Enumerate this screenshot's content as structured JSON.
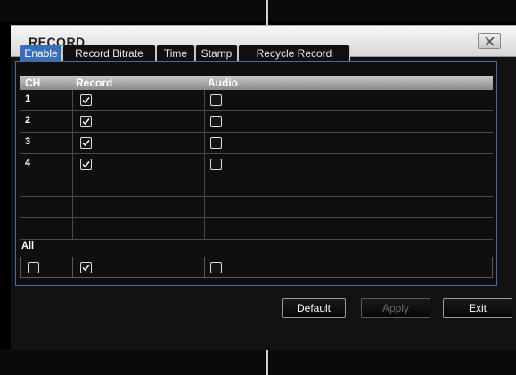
{
  "dialog": {
    "title": "RECORD"
  },
  "tabs": [
    {
      "label": "Enable",
      "active": true
    },
    {
      "label": "Record Bitrate",
      "active": false
    },
    {
      "label": "Time",
      "active": false
    },
    {
      "label": "Stamp",
      "active": false
    },
    {
      "label": "Recycle Record",
      "active": false
    }
  ],
  "table": {
    "headers": [
      "CH",
      "Record",
      "Audio"
    ],
    "rows": [
      {
        "ch": "1",
        "record": true,
        "audio": false
      },
      {
        "ch": "2",
        "record": true,
        "audio": false
      },
      {
        "ch": "3",
        "record": true,
        "audio": false
      },
      {
        "ch": "4",
        "record": true,
        "audio": false
      }
    ]
  },
  "all": {
    "label": "All",
    "ch_checked": false,
    "record_checked": true,
    "audio_checked": false
  },
  "buttons": {
    "default_label": "Default",
    "apply_label": "Apply",
    "exit_label": "Exit"
  },
  "colors": {
    "active_tab": "#3a6fb8",
    "panel_border": "#4a6aa0"
  }
}
